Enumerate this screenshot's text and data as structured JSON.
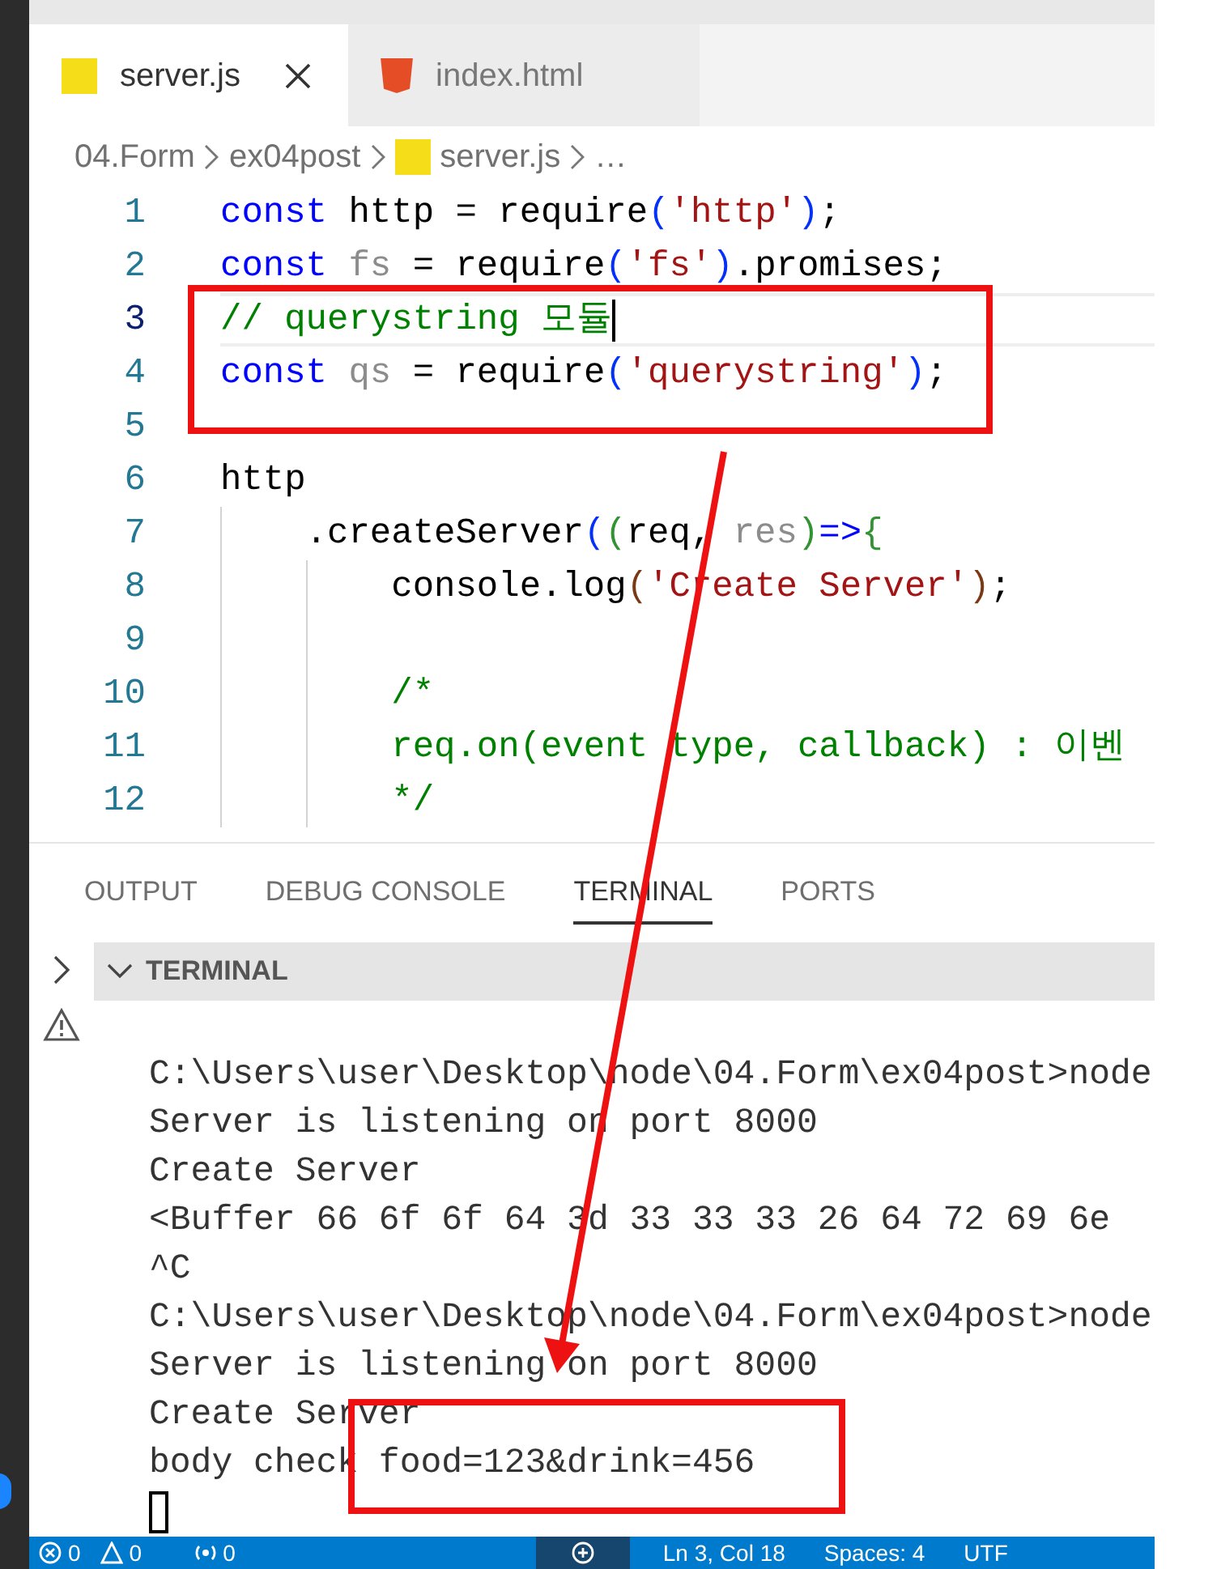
{
  "tabs": [
    {
      "label": "server.js",
      "kind": "js",
      "selected": true,
      "closable": true
    },
    {
      "label": "index.html",
      "kind": "html",
      "selected": false,
      "closable": false
    }
  ],
  "breadcrumb": [
    {
      "label": "04.Form",
      "kind": "folder"
    },
    {
      "label": "ex04post",
      "kind": "folder"
    },
    {
      "label": "server.js",
      "kind": "js"
    },
    {
      "label": "…",
      "kind": "more"
    }
  ],
  "code": {
    "lines": [
      {
        "number": "1",
        "current": false,
        "tokens": [
          {
            "kind": "keyword",
            "text": "const"
          },
          {
            "kind": "plain",
            "text": " http = require"
          },
          {
            "kind": "bracket1",
            "text": "("
          },
          {
            "kind": "string",
            "text": "'http'"
          },
          {
            "kind": "bracket1",
            "text": ")"
          },
          {
            "kind": "plain",
            "text": ";"
          }
        ]
      },
      {
        "number": "2",
        "current": false,
        "tokens": [
          {
            "kind": "keyword",
            "text": "const"
          },
          {
            "kind": "unused",
            "text": " fs"
          },
          {
            "kind": "plain",
            "text": " = require"
          },
          {
            "kind": "bracket1",
            "text": "("
          },
          {
            "kind": "string",
            "text": "'fs'"
          },
          {
            "kind": "bracket1",
            "text": ")"
          },
          {
            "kind": "plain",
            "text": ".promises;"
          }
        ]
      },
      {
        "number": "3",
        "current": true,
        "tokens": [
          {
            "kind": "comment",
            "text": "// querystring 모듈"
          }
        ]
      },
      {
        "number": "4",
        "current": false,
        "tokens": [
          {
            "kind": "keyword",
            "text": "const"
          },
          {
            "kind": "unused",
            "text": " qs"
          },
          {
            "kind": "plain",
            "text": " = require"
          },
          {
            "kind": "bracket1",
            "text": "("
          },
          {
            "kind": "string",
            "text": "'querystring'"
          },
          {
            "kind": "bracket1",
            "text": ")"
          },
          {
            "kind": "plain",
            "text": ";"
          }
        ]
      },
      {
        "number": "5",
        "current": false
      },
      {
        "number": "6",
        "current": false,
        "tokens": [
          {
            "kind": "plain",
            "text": "http"
          }
        ]
      },
      {
        "number": "7",
        "current": false,
        "tokens": [
          {
            "kind": "plain",
            "text": "    .createServer"
          },
          {
            "kind": "bracket1",
            "text": "("
          },
          {
            "kind": "bracket2",
            "text": "("
          },
          {
            "kind": "plain",
            "text": "req, "
          },
          {
            "kind": "unused",
            "text": "res"
          },
          {
            "kind": "bracket2",
            "text": ")"
          },
          {
            "kind": "keyword",
            "text": "=>"
          },
          {
            "kind": "bracket2",
            "text": "{"
          }
        ]
      },
      {
        "number": "8",
        "current": false,
        "tokens": [
          {
            "kind": "plain",
            "text": "        console.log"
          },
          {
            "kind": "bracket3",
            "text": "("
          },
          {
            "kind": "string",
            "text": "'Create Server'"
          },
          {
            "kind": "bracket3",
            "text": ")"
          },
          {
            "kind": "plain",
            "text": ";"
          }
        ]
      },
      {
        "number": "9",
        "current": false
      },
      {
        "number": "10",
        "current": false,
        "tokens": [
          {
            "kind": "comment",
            "text": "        /*"
          }
        ]
      },
      {
        "number": "11",
        "current": false,
        "tokens": [
          {
            "kind": "comment",
            "text": "        req.on(event type, callback) : 이벤"
          }
        ]
      },
      {
        "number": "12",
        "current": false,
        "tokens": [
          {
            "kind": "comment",
            "text": "        */"
          }
        ]
      }
    ]
  },
  "panel_tabs": [
    {
      "label": "OUTPUT",
      "selected": false
    },
    {
      "label": "DEBUG CONSOLE",
      "selected": false
    },
    {
      "label": "TERMINAL",
      "selected": true
    },
    {
      "label": "PORTS",
      "selected": false
    }
  ],
  "terminal": {
    "title": "TERMINAL",
    "expanded": true,
    "cursor": true,
    "lines": [
      "C:\\Users\\user\\Desktop\\node\\04.Form\\ex04post>node",
      "Server is listening on port 8000",
      "Create Server",
      "<Buffer 66 6f 6f 64 3d 33 33 33 26 64 72 69 6e",
      "^C",
      "C:\\Users\\user\\Desktop\\node\\04.Form\\ex04post>node",
      "Server is listening on port 8000",
      "Create Server",
      "body check food=123&drink=456"
    ]
  },
  "status_bar": {
    "errors": "0",
    "warnings": "0",
    "ports": "0",
    "position": "Ln 3, Col 18",
    "spaces": "Spaces: 4",
    "encoding": "UTF"
  }
}
